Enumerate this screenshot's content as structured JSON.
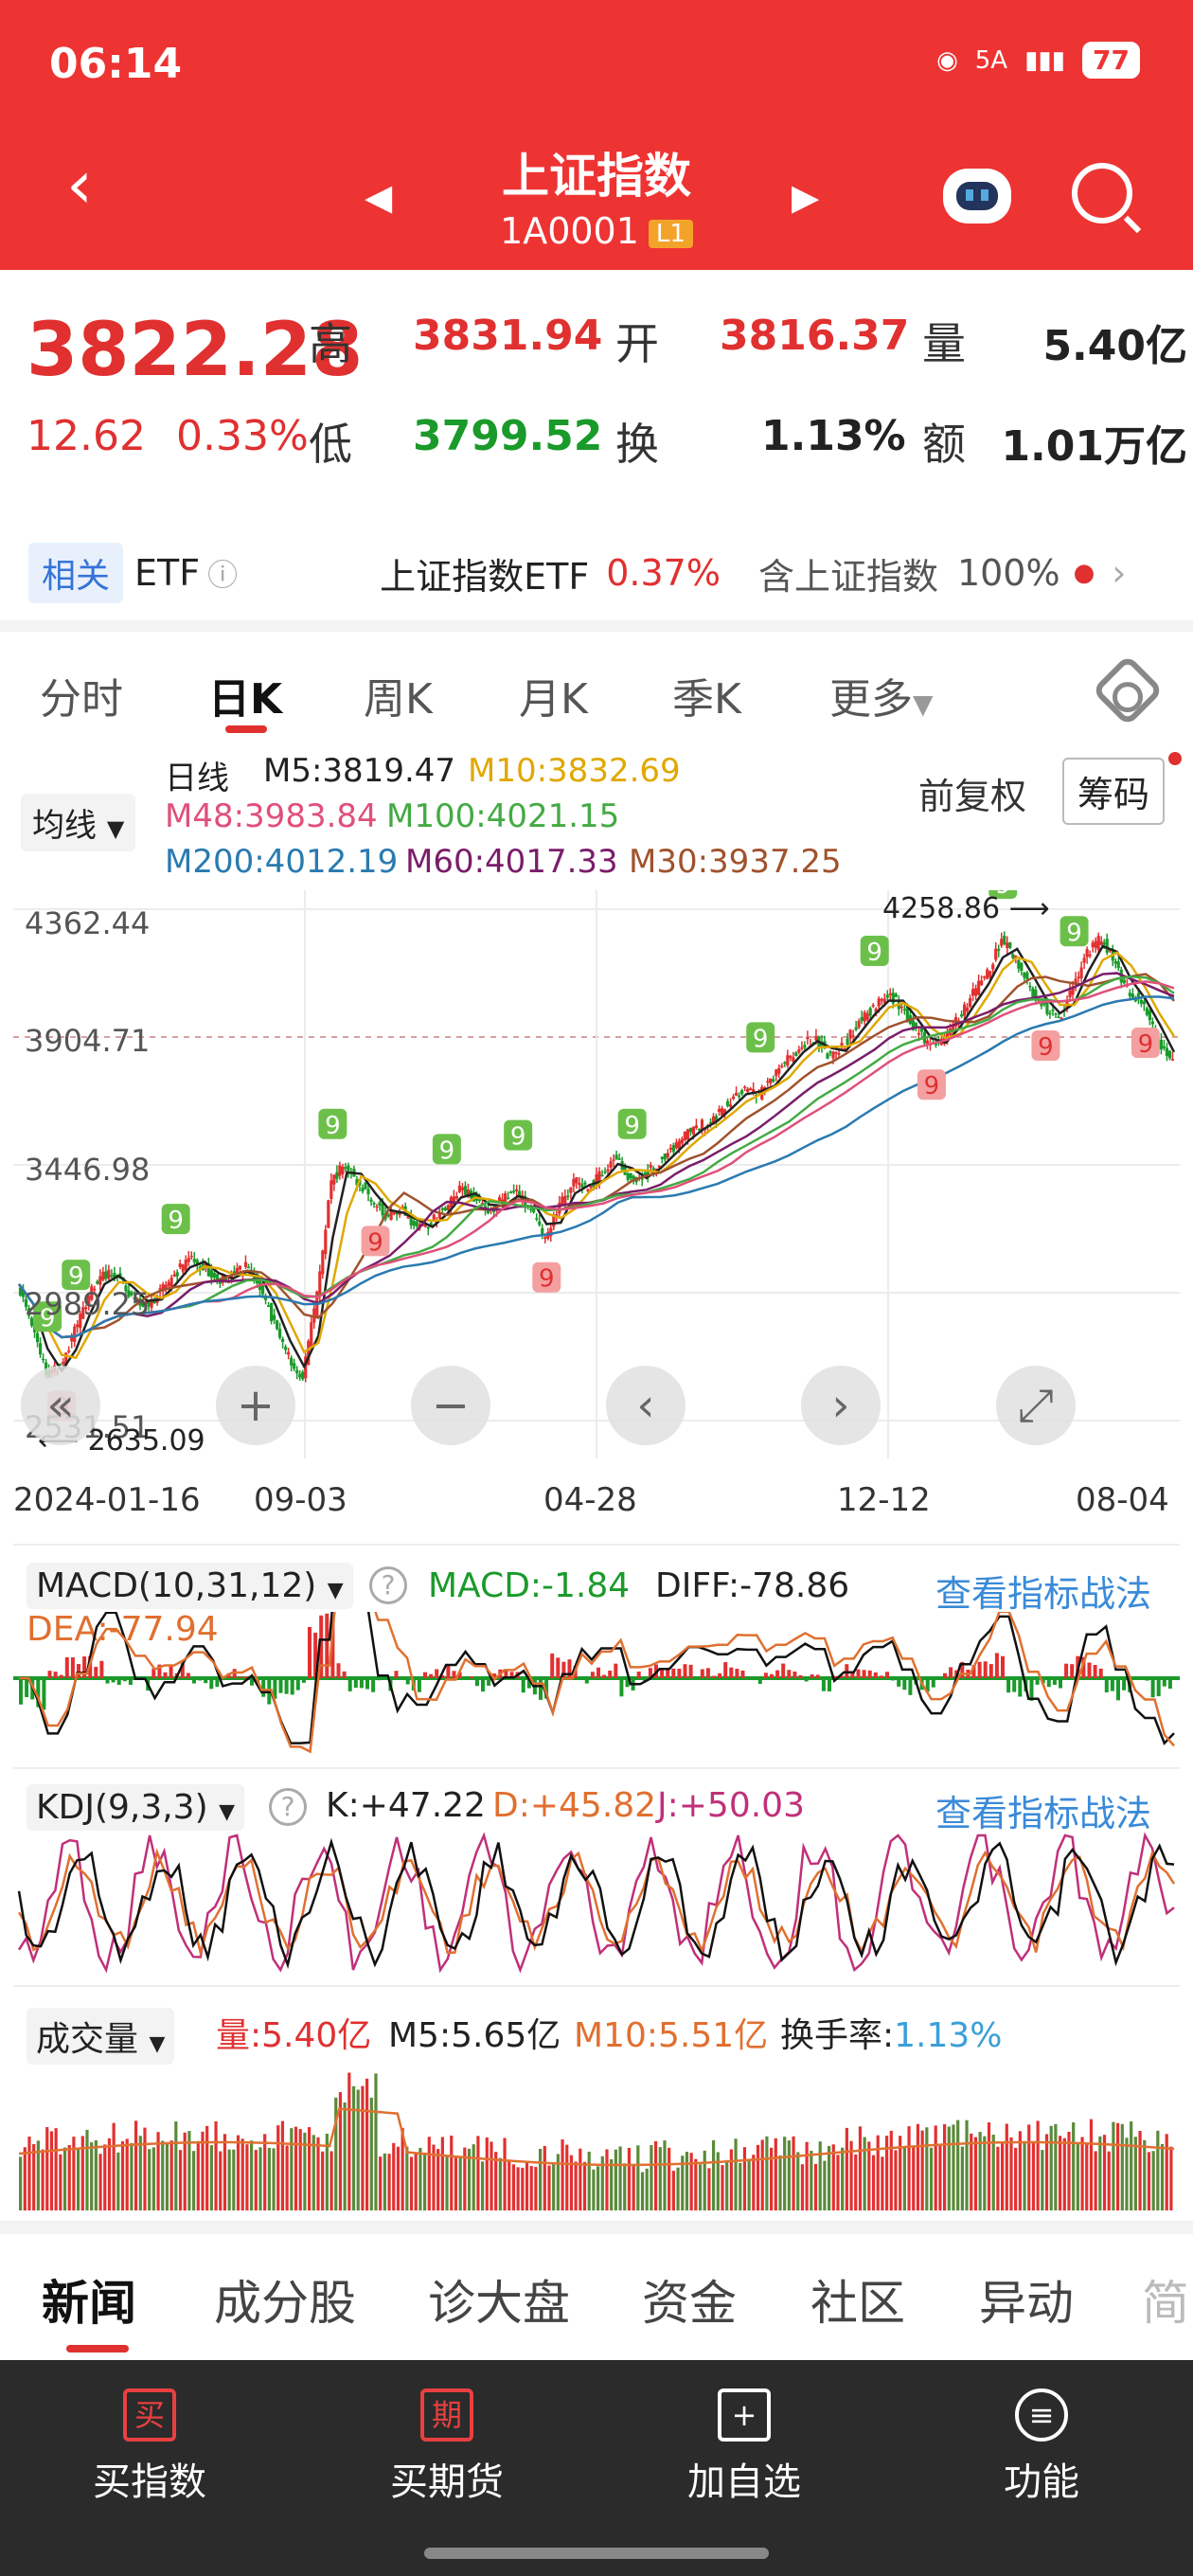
{
  "status": {
    "time": "06:14",
    "network": "5A",
    "battery": "77"
  },
  "header": {
    "title": "上证指数",
    "code": "1A0001",
    "level": "L1"
  },
  "quote": {
    "price": "3822.28",
    "change": "12.62",
    "change_pct": "0.33%",
    "high_label": "高",
    "high": "3831.94",
    "open_label": "开",
    "open": "3816.37",
    "vol_label": "量",
    "volume": "5.40亿",
    "low_label": "低",
    "low": "3799.52",
    "turnover_label": "换",
    "turnover": "1.13%",
    "amount_label": "额",
    "amount": "1.01万亿"
  },
  "etf": {
    "tag": "相关",
    "label": "ETF",
    "name": "上证指数ETF",
    "pct": "0.37%",
    "hold_label": "含上证指数",
    "hold_pct": "100%"
  },
  "tabs": [
    "分时",
    "日K",
    "周K",
    "月K",
    "季K",
    "更多"
  ],
  "ma": {
    "button": "均线",
    "line_label": "日线",
    "fq": "前复权",
    "chips": "筹码",
    "items": [
      {
        "text": "M5:3819.47",
        "color": "#222222"
      },
      {
        "text": "M10:3832.69",
        "color": "#e0a800"
      },
      {
        "text": "M48:3983.84",
        "color": "#e0507a"
      },
      {
        "text": "M100:4021.15",
        "color": "#44aa44"
      },
      {
        "text": "M200:4012.19",
        "color": "#2a7ab0"
      },
      {
        "text": "M60:4017.33",
        "color": "#7a1d6a"
      },
      {
        "text": "M30:3937.25",
        "color": "#a0522d"
      }
    ]
  },
  "chart_data": {
    "type": "line",
    "y_ticks": [
      "4362.44",
      "3904.71",
      "3446.98",
      "2989.25",
      "2531.51"
    ],
    "ylim": [
      2531.51,
      4362.44
    ],
    "max_label": "4258.86",
    "min_label": "2635.09",
    "x_ticks": [
      "2024-01-16",
      "09-03",
      "04-28",
      "12-12",
      "08-04"
    ],
    "series": [
      {
        "values": [
          3020,
          2880,
          2700,
          2720,
          2850,
          2980,
          3060,
          3040,
          2980,
          2940,
          2990,
          3050,
          3110,
          3090,
          3030,
          3050,
          3080,
          3010,
          2880,
          2760,
          2690,
          2980,
          3390,
          3450,
          3380,
          3310,
          3260,
          3290,
          3210,
          3240,
          3300,
          3360,
          3330,
          3280,
          3320,
          3350,
          3290,
          3180,
          3300,
          3390,
          3360,
          3420,
          3480,
          3390,
          3410,
          3460,
          3510,
          3560,
          3590,
          3620,
          3680,
          3720,
          3700,
          3760,
          3820,
          3880,
          3900,
          3830,
          3880,
          3960,
          4010,
          4060,
          4010,
          3930,
          3870,
          3900,
          3980,
          4060,
          4130,
          4250,
          4190,
          4080,
          4010,
          3970,
          4080,
          4200,
          4260,
          4160,
          4060,
          4020,
          3880,
          3822.28
        ]
      }
    ]
  },
  "macd": {
    "label": "MACD(10,31,12)",
    "macd": "MACD:-1.84",
    "diff": "DIFF:-78.86",
    "dea": "DEA:-77.94",
    "link": "查看指标战法"
  },
  "kdj": {
    "label": "KDJ(9,3,3)",
    "k": "K:+47.22",
    "d": "D:+45.82",
    "j": "J:+50.03",
    "link": "查看指标战法"
  },
  "vol": {
    "label": "成交量",
    "v": "量:5.40亿",
    "m5": "M5:5.65亿",
    "m10": "M10:5.51亿",
    "turn_label": "换手率:",
    "turn": "1.13%"
  },
  "news_tabs": [
    "新闻",
    "成分股",
    "诊大盘",
    "资金",
    "社区",
    "异动",
    "简"
  ],
  "bottom": [
    {
      "icon": "买",
      "label": "买指数"
    },
    {
      "icon": "期",
      "label": "买期货"
    },
    {
      "icon": "+",
      "label": "加自选"
    },
    {
      "icon": "≡",
      "label": "功能"
    }
  ]
}
